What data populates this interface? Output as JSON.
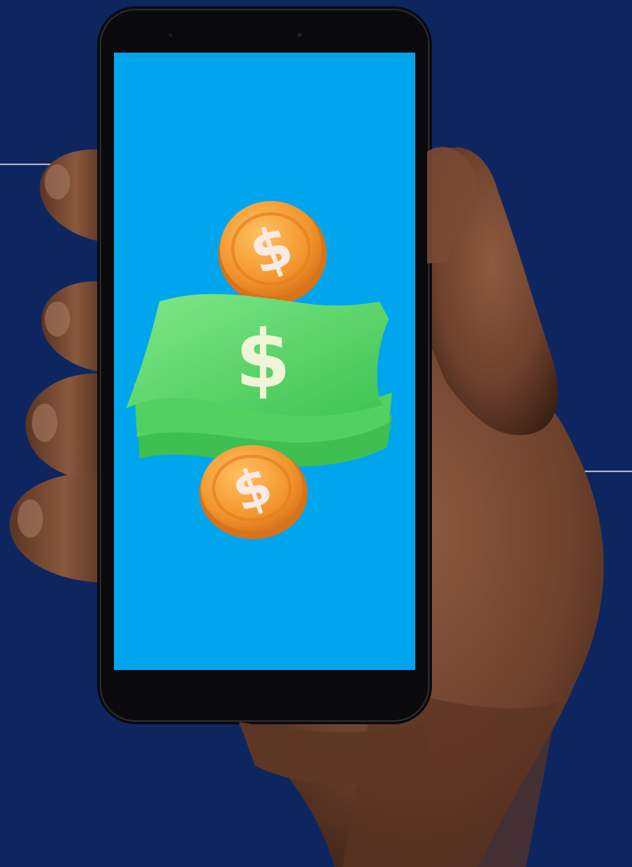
{
  "background": {
    "color": "#0e2660"
  },
  "phone": {
    "body_color": "#0a0a0c",
    "screen_color": "#00a6ed"
  },
  "artwork": {
    "coin_color": "#f2942b",
    "coin_symbol": "$",
    "bill_color": "#5fd86a",
    "bill_symbol": "$"
  },
  "skin_color": "#7a4a33",
  "accent_lines_color": "#ffffff"
}
